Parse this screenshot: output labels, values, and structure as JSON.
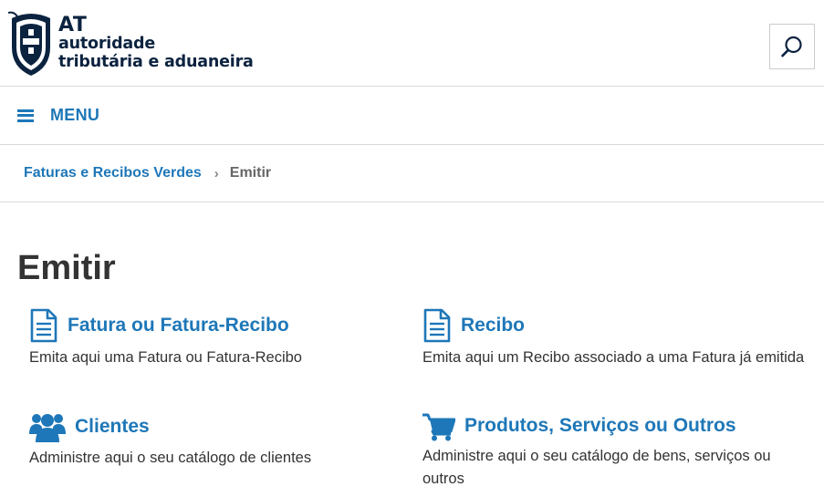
{
  "header": {
    "logo": {
      "line1": "AT",
      "line2": "autoridade",
      "line3": "tributária e aduaneira"
    },
    "search_icon": "search-icon"
  },
  "menu": {
    "label": "MENU",
    "icon": "hamburger-icon"
  },
  "breadcrumb": {
    "parent": "Faturas e Recibos Verdes",
    "separator": "›",
    "current": "Emitir"
  },
  "main": {
    "title": "Emitir",
    "cards": [
      {
        "title": "Fatura ou Fatura-Recibo",
        "description": "Emita aqui uma Fatura ou Fatura-Recibo",
        "icon": "document-icon"
      },
      {
        "title": "Recibo",
        "description": "Emita aqui um Recibo associado a uma Fatura já emitida",
        "icon": "document-icon"
      },
      {
        "title": "Clientes",
        "description": "Administre aqui o seu catálogo de clientes",
        "icon": "users-icon"
      },
      {
        "title": "Produtos, Serviços ou Outros",
        "description": "Administre aqui o seu catálogo de bens, serviços ou outros",
        "icon": "shopping-cart-icon"
      }
    ]
  },
  "colors": {
    "link_blue": "#1e77b8",
    "logo_navy": "#0c2340",
    "text": "#333333",
    "divider": "#d9d9d9"
  }
}
